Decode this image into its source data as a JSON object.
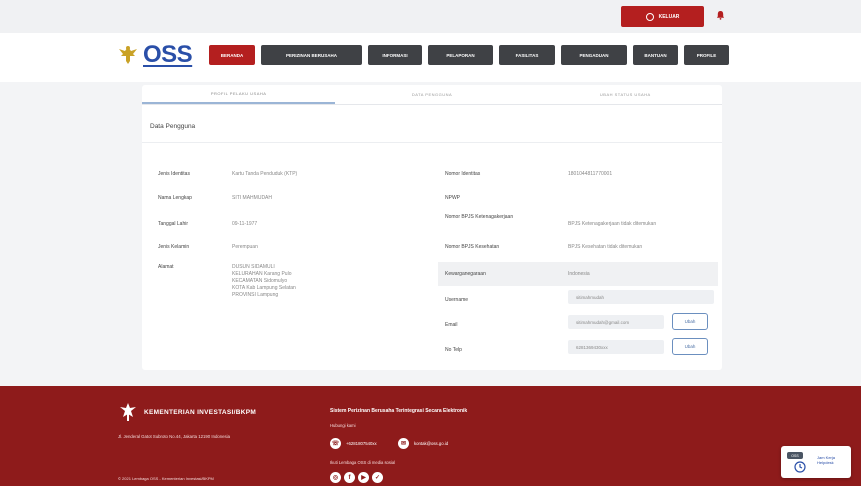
{
  "topbar": {
    "logout_label": "KELUAR"
  },
  "brand": {
    "logo_text": "OSS"
  },
  "nav": [
    "BERANDA",
    "PERIZINAN BERUSAHA",
    "INFORMASI",
    "PELAPORAN",
    "FASILITAS",
    "PENGADUAN",
    "BANTUAN",
    "PROFILE"
  ],
  "tabs": [
    "PROFIL PELAKU USAHA",
    "DATA PENGGUNA",
    "UBAH STATUS USAHA"
  ],
  "section_title": "Data Pengguna",
  "left_fields": [
    {
      "label": "Jenis Identitas",
      "value": "Kartu Tanda Penduduk (KTP)"
    },
    {
      "label": "Nama Lengkap",
      "value": "SITI MAHMUDAH"
    },
    {
      "label": "Tanggal Lahir",
      "value": "09-11-1977"
    },
    {
      "label": "Jenis Kelamin",
      "value": "Perempuan"
    },
    {
      "label": "Alamat",
      "value": "DUSUN SIDAMULI\nKELURAHAN Karang Pulo\nKECAMATAN Sidomulyo\nKOTA Kab Lampung Selatan\nPROVINSI Lampung"
    }
  ],
  "right_fields": [
    {
      "label": "Nomor Identitas",
      "value": "1801044811770001"
    },
    {
      "label": "NPWP",
      "value": ""
    },
    {
      "label": "Nomor BPJS Ketenagakerjaan",
      "value": "BPJS Ketenagakerjaan tidak ditemukan"
    },
    {
      "label": "Nomor BPJS Kesehatan",
      "value": "BPJS Kesehatan tidak ditemukan"
    },
    {
      "label": "Kewarganegaraan",
      "value": "Indonesia"
    }
  ],
  "account": {
    "username_label": "Username",
    "username_value": "sitimahmudah",
    "email_label": "Email",
    "email_value": "sitimahmudah@gmail.com",
    "phone_label": "No Telp",
    "phone_value": "6281369430xxx",
    "change_label": "Ubah"
  },
  "footer": {
    "ministry": "KEMENTERIAN INVESTASI/BKPM",
    "address": "Jl. Jenderal Gatot Subroto No.44, Jakarta 12190 Indonesia",
    "copyright": "© 2021 Lembaga OSS - Kementerian Investasi/BKPM",
    "system_title": "Sistem Perizinan Berusaha Terintegrasi Secara Elektronik",
    "contact_heading": "Hubungi kami",
    "phone": "+6281807540xx",
    "email": "kontak@oss.go.id",
    "social_heading": "Ikuti Lembaga OSS di media sosial"
  },
  "help_widget": {
    "badge": "OSS",
    "text": "Jam Kerja Helpdesk"
  },
  "colors": {
    "brand_red": "#b41f1f",
    "footer_red": "#8e1b1b",
    "nav_dark": "#3f4145",
    "logo_blue": "#2a4fa8"
  }
}
